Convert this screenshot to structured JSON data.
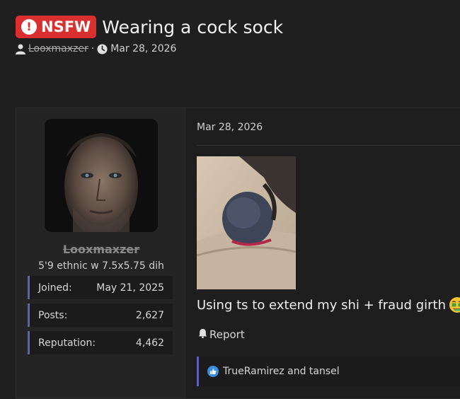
{
  "thread": {
    "badge": "NSFW",
    "title": "Wearing a cock sock",
    "author": "Looxmaxzer",
    "separator": "·",
    "date": "Mar 28, 2026"
  },
  "post": {
    "user": {
      "name": "Looxmaxzer",
      "title": "5'9 ethnic w 7.5x5.75 dih",
      "stats": [
        {
          "label": "Joined:",
          "value": "May 21, 2025"
        },
        {
          "label": "Posts:",
          "value": "2,627"
        },
        {
          "label": "Reputation:",
          "value": "4,462"
        }
      ]
    },
    "date": "Mar 28, 2026",
    "body": "Using ts to extend my shi + fraud girth",
    "report_label": "Report",
    "reactions_text": "TrueRamirez and tansel"
  },
  "icons": {
    "author": "user-icon",
    "date": "clock-icon",
    "report": "bell-icon",
    "reaction": "like-icon",
    "badge": "exclamation-icon",
    "emoji": "money-mouth-emoji"
  },
  "colors": {
    "badge": "#d9302f",
    "accent": "#5b63b0",
    "like": "#3a8fe0"
  }
}
